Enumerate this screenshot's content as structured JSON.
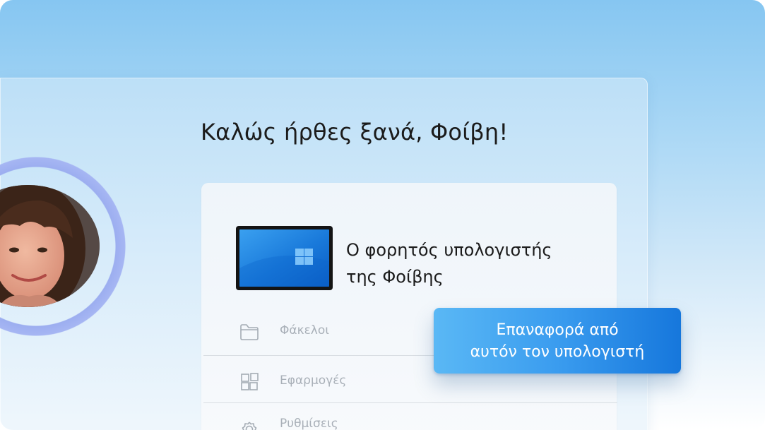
{
  "welcome": {
    "title": "Καλώς ήρθες ξανά, Φοίβη!"
  },
  "device": {
    "name_line1": "Ο φορητός υπολογιστής",
    "name_line2": "της Φοίβης",
    "icon": "laptop-screen-windows-logo"
  },
  "menu": {
    "items": [
      {
        "label": "Φάκελοι",
        "icon": "folder-icon"
      },
      {
        "label": "Εφαρμογές",
        "icon": "apps-icon"
      },
      {
        "label": "Ρυθμίσεις",
        "icon": "gear-icon"
      }
    ]
  },
  "restore_button": {
    "line1": "Επαναφορά από",
    "line2": "αυτόν τον υπολογιστή"
  },
  "colors": {
    "accent_blue": "#1677dc",
    "ring": "#a6b6f3",
    "muted_text": "#a9b0b8"
  }
}
